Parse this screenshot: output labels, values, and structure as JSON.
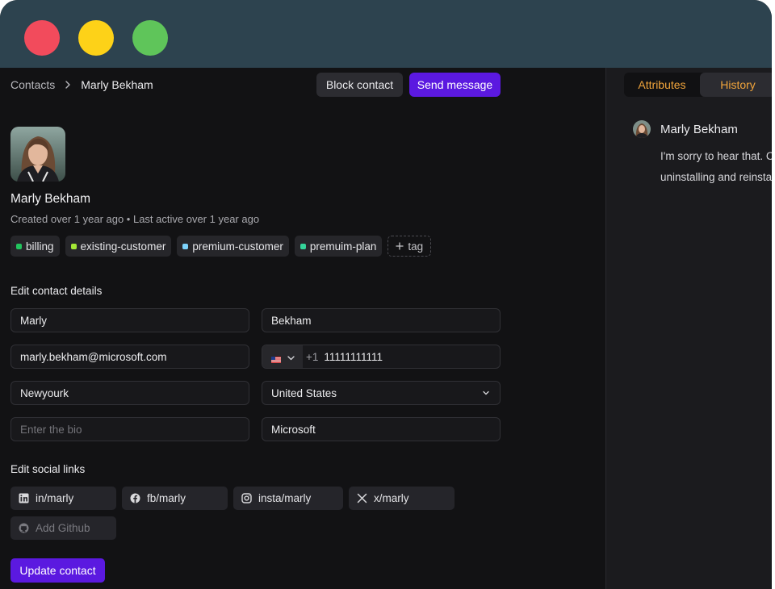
{
  "breadcrumb": {
    "root": "Contacts",
    "current": "Marly Bekham"
  },
  "header_actions": {
    "block": "Block contact",
    "send": "Send message"
  },
  "contact": {
    "name": "Marly Bekham",
    "meta": "Created over 1 year ago • Last active over 1 year ago"
  },
  "tags": [
    {
      "label": "billing",
      "color": "#22c55e"
    },
    {
      "label": "existing-customer",
      "color": "#a3e635"
    },
    {
      "label": "premium-customer",
      "color": "#7dd3fc"
    },
    {
      "label": "premuim-plan",
      "color": "#34d399"
    }
  ],
  "add_tag": "tag",
  "edit_details": {
    "title": "Edit contact details",
    "first_name": "Marly",
    "last_name": "Bekham",
    "email": "marly.bekham@microsoft.com",
    "phone_code": "+1",
    "phone_number": "11111111111",
    "city": "Newyourk",
    "country": "United States",
    "bio_placeholder": "Enter the bio",
    "company": "Microsoft"
  },
  "social": {
    "title": "Edit social links",
    "linkedin": "in/marly",
    "facebook": "fb/marly",
    "instagram": "insta/marly",
    "x": "x/marly",
    "github_placeholder": "Add Github"
  },
  "update_button": "Update contact",
  "side": {
    "tabs": [
      "Attributes",
      "History"
    ],
    "message_author": "Marly Bekham",
    "message_line1": "I'm sorry to hear that. C",
    "message_line2": "uninstalling and reinsta"
  },
  "colors": {
    "accent": "#5b19e0",
    "tab_text": "#f0a43b",
    "titlebar": "#2d434f"
  }
}
